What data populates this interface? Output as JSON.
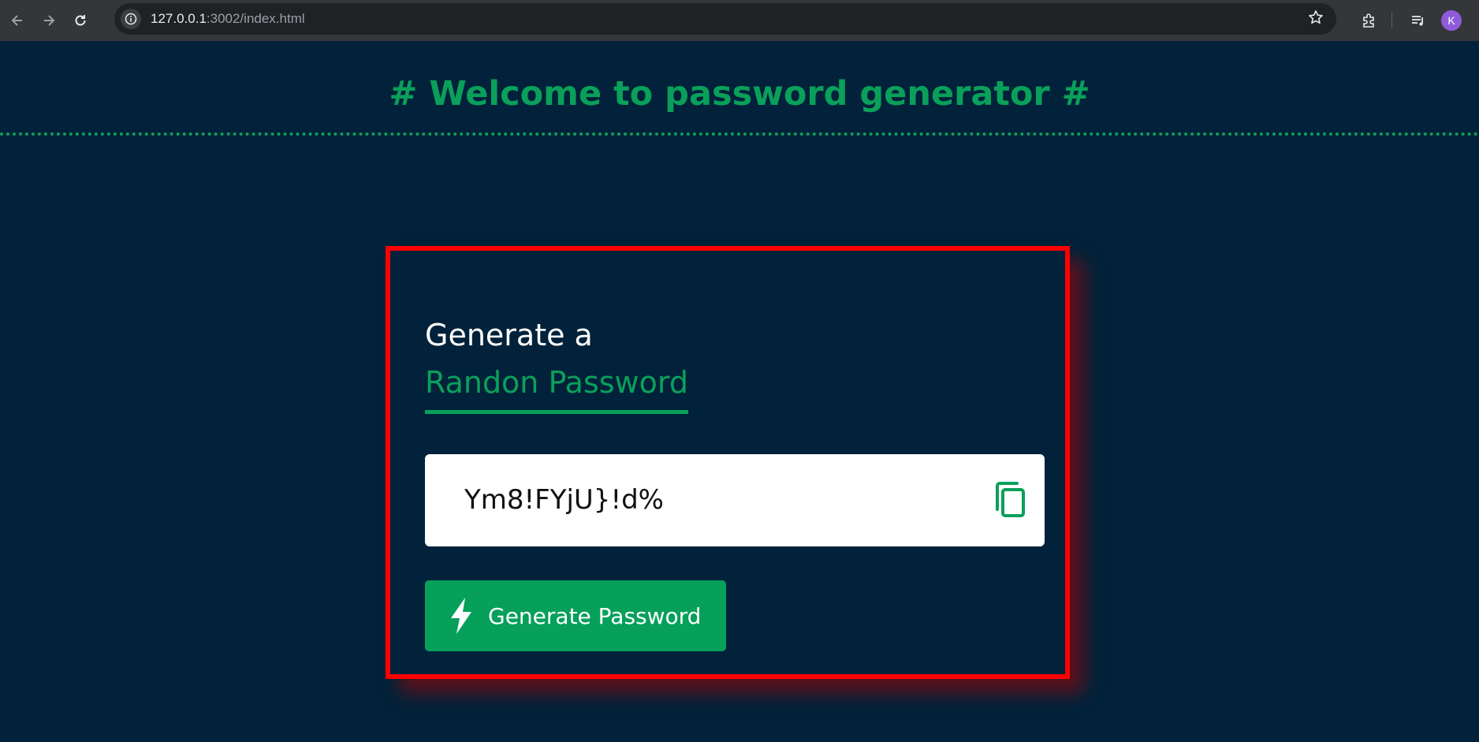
{
  "browser": {
    "url_host": "127.0.0.1",
    "url_path": ":3002/index.html",
    "profile_initial": "K"
  },
  "page": {
    "title": "# Welcome to password generator #"
  },
  "card": {
    "heading": "Generate a",
    "subheading": "Randon Password",
    "password_value": "Ym8!FYjU}!d%",
    "generate_button_label": "Generate Password"
  },
  "colors": {
    "background": "#01223a",
    "accent_green": "#0aa05a",
    "card_border": "#ff0000"
  },
  "icons": {
    "copy": "copy-icon",
    "generate": "lightning-bolt-icon"
  }
}
